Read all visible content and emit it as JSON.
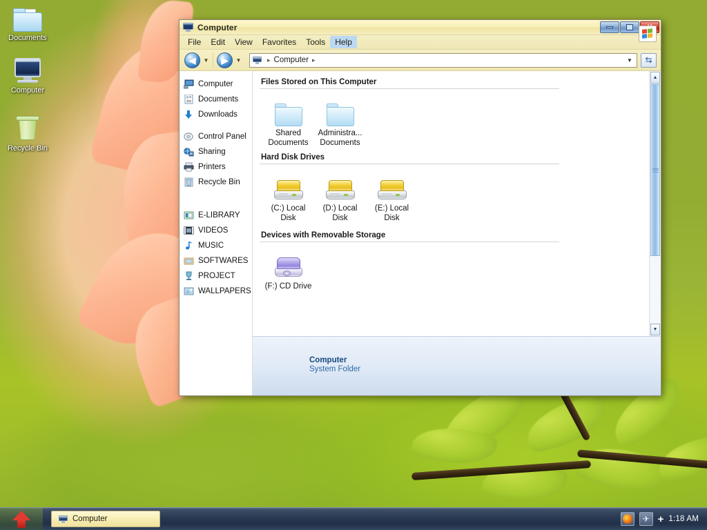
{
  "desktop": {
    "icons": [
      {
        "label": "Documents",
        "icon": "folder-icon"
      },
      {
        "label": "Computer",
        "icon": "computer-monitor-icon"
      },
      {
        "label": "Recycle Bin",
        "icon": "recycle-bin-icon"
      }
    ]
  },
  "window": {
    "title": "Computer",
    "title_icon": "computer-monitor-icon",
    "controls": {
      "minimize": "minimize-icon",
      "maximize": "maximize-icon",
      "close": "X"
    },
    "menu": [
      {
        "label": "File",
        "active": false
      },
      {
        "label": "Edit",
        "active": false
      },
      {
        "label": "View",
        "active": false
      },
      {
        "label": "Favorites",
        "active": false
      },
      {
        "label": "Tools",
        "active": false
      },
      {
        "label": "Help",
        "active": true
      }
    ],
    "logo": "windows-flag-logo",
    "toolbar": {
      "back": "◀",
      "forward": "▶",
      "back_dropdown": "▼",
      "forward_dropdown": "▼",
      "address_icon": "computer-monitor-icon",
      "breadcrumbs": [
        "Computer"
      ],
      "breadcrumb_separator": "▸",
      "address_dropdown": "▼",
      "go_button": "⇆"
    },
    "sidebar": {
      "groups": [
        [
          {
            "label": "Computer",
            "icon": "computer-monitor-icon"
          },
          {
            "label": "Documents",
            "icon": "documents-icon"
          },
          {
            "label": "Downloads",
            "icon": "downloads-arrow-icon"
          }
        ],
        [
          {
            "label": "Control Panel",
            "icon": "control-panel-icon"
          },
          {
            "label": "Sharing",
            "icon": "sharing-globe-icon"
          },
          {
            "label": "Printers",
            "icon": "printer-icon"
          },
          {
            "label": "Recycle Bin",
            "icon": "recycle-bin-icon"
          }
        ],
        [
          {
            "label": "E-LIBRARY",
            "icon": "library-folder-icon"
          },
          {
            "label": "VIDEOS",
            "icon": "video-film-icon"
          },
          {
            "label": "MUSIC",
            "icon": "music-note-icon"
          },
          {
            "label": "SOFTWARES",
            "icon": "softwares-folder-icon"
          },
          {
            "label": "PROJECT",
            "icon": "trophy-icon"
          },
          {
            "label": "WALLPAPERS",
            "icon": "wallpaper-image-icon"
          }
        ]
      ]
    },
    "sections": [
      {
        "heading": "Files Stored on This Computer",
        "items": [
          {
            "line1": "Shared",
            "line2": "Documents",
            "icon": "blue-folder-icon"
          },
          {
            "line1": "Administra...",
            "line2": "Documents",
            "icon": "blue-folder-icon"
          }
        ]
      },
      {
        "heading": "Hard Disk Drives",
        "items": [
          {
            "line1": "(C:) Local",
            "line2": "Disk",
            "icon": "hard-disk-icon"
          },
          {
            "line1": "(D:) Local",
            "line2": "Disk",
            "icon": "hard-disk-icon"
          },
          {
            "line1": "(E:) Local",
            "line2": "Disk",
            "icon": "hard-disk-icon"
          }
        ]
      },
      {
        "heading": "Devices with Removable Storage",
        "items": [
          {
            "line1": "(F:) CD Drive",
            "line2": "",
            "icon": "cd-drive-icon"
          }
        ]
      }
    ],
    "details": {
      "title": "Computer",
      "subtitle": "System Folder"
    },
    "scrollbar": {
      "up": "▲",
      "down": "▼"
    }
  },
  "taskbar": {
    "start_button": "start-arrow-icon",
    "tasks": [
      {
        "label": "Computer",
        "icon": "computer-monitor-icon"
      }
    ],
    "tray": {
      "icons": [
        "firefox-icon",
        "app-icon"
      ],
      "plus": "+",
      "clock": "1:18 AM"
    }
  },
  "colors": {
    "title_bar": "#f7efb8",
    "menu_highlight": "#bcd9f3",
    "close_button": "#b8221a",
    "details_title": "#16487c",
    "details_subtitle": "#2f6aa8",
    "desktop_green": "#93ab32",
    "taskbar": "#2a3a52"
  }
}
